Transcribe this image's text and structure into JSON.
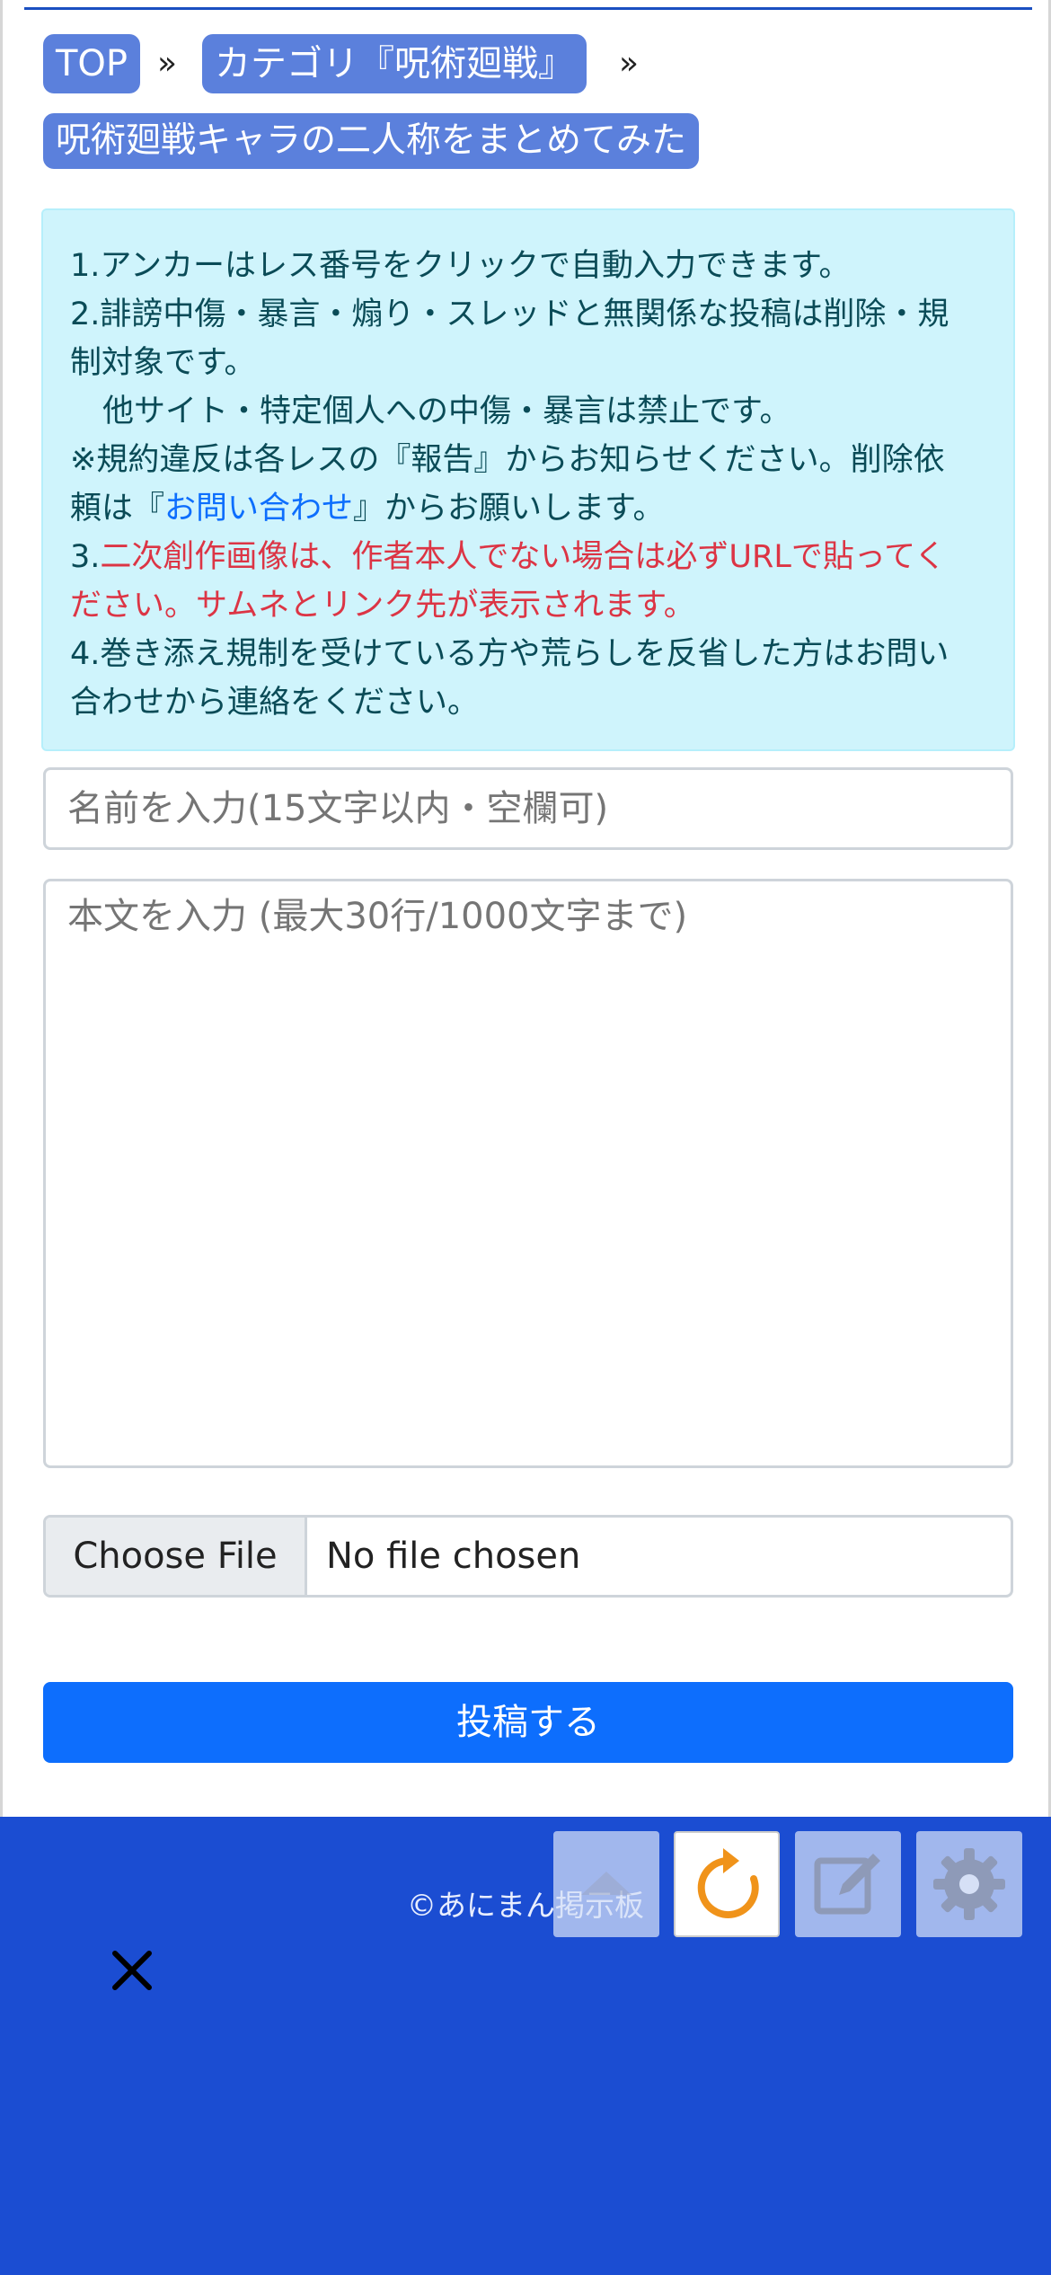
{
  "breadcrumb": {
    "top": "TOP",
    "separator": "»",
    "category": "カテゴリ『呪術廻戦』",
    "thread_title": "呪術廻戦キャラの二人称をまとめてみた"
  },
  "notice": {
    "line1": "1.アンカーはレス番号をクリックで自動入力できます。",
    "line2a": "2.誹謗中傷・暴言・煽り・スレッドと無関係な投稿は削除・規",
    "line2b": "制対象です。",
    "line3": "他サイト・特定個人への中傷・暴言は禁止です。",
    "line4a": "※規約違反は各レスの『報告』からお知らせください。削除依",
    "line4b_prefix": "頼は『",
    "line4b_link": "お問い合わせ",
    "line4b_suffix": "』からお願いします。",
    "line5a_num": "3.",
    "line5a_red": "二次創作画像は、作者本人でない場合は必ずURLで貼ってく",
    "line5b_red": "ださい。サムネとリンク先が表示されます。",
    "line6a": "4.巻き添え規制を受けている方や荒らしを反省した方はお問い",
    "line6b": "合わせから連絡をください。"
  },
  "form": {
    "name_placeholder": "名前を入力(15文字以内・空欄可)",
    "body_placeholder": "本文を入力 (最大30行/1000文字まで)",
    "file_button": "Choose File",
    "file_status": "No file chosen",
    "submit_label": "投稿する"
  },
  "footer": {
    "copyright": "©あにまん掲示板"
  },
  "toolbar": {
    "icons": [
      "scroll-top-icon",
      "reload-icon",
      "edit-icon",
      "settings-icon"
    ]
  },
  "colors": {
    "accent": "#0d6efd",
    "footer": "#1b4dd2",
    "breadcrumb": "#5b80dc",
    "notice_bg": "#cff4fc",
    "warning_text": "#dc3545",
    "reload_orange": "#f0931a"
  }
}
